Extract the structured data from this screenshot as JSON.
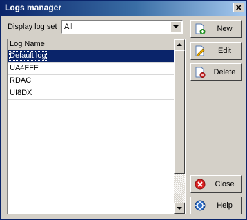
{
  "window": {
    "title": "Logs manager"
  },
  "toolbar": {
    "display_label": "Display log set",
    "display_value": "All"
  },
  "list": {
    "column_header": "Log Name",
    "rows": [
      "Default log",
      "UA4FFF",
      "RDAC",
      "UI8DX"
    ]
  },
  "buttons": {
    "new": "New",
    "edit": "Edit",
    "delete": "Delete",
    "close": "Close",
    "help": "Help"
  },
  "icons": {
    "title_close": "close-icon",
    "new": "new-document-icon",
    "edit": "edit-document-icon",
    "delete": "delete-document-icon",
    "close": "red-close-circle-icon",
    "help": "help-circle-icon"
  },
  "colors": {
    "selection": "#0a246a",
    "title_start": "#0a246a",
    "title_end": "#a6caf0",
    "face": "#d4d0c8"
  }
}
